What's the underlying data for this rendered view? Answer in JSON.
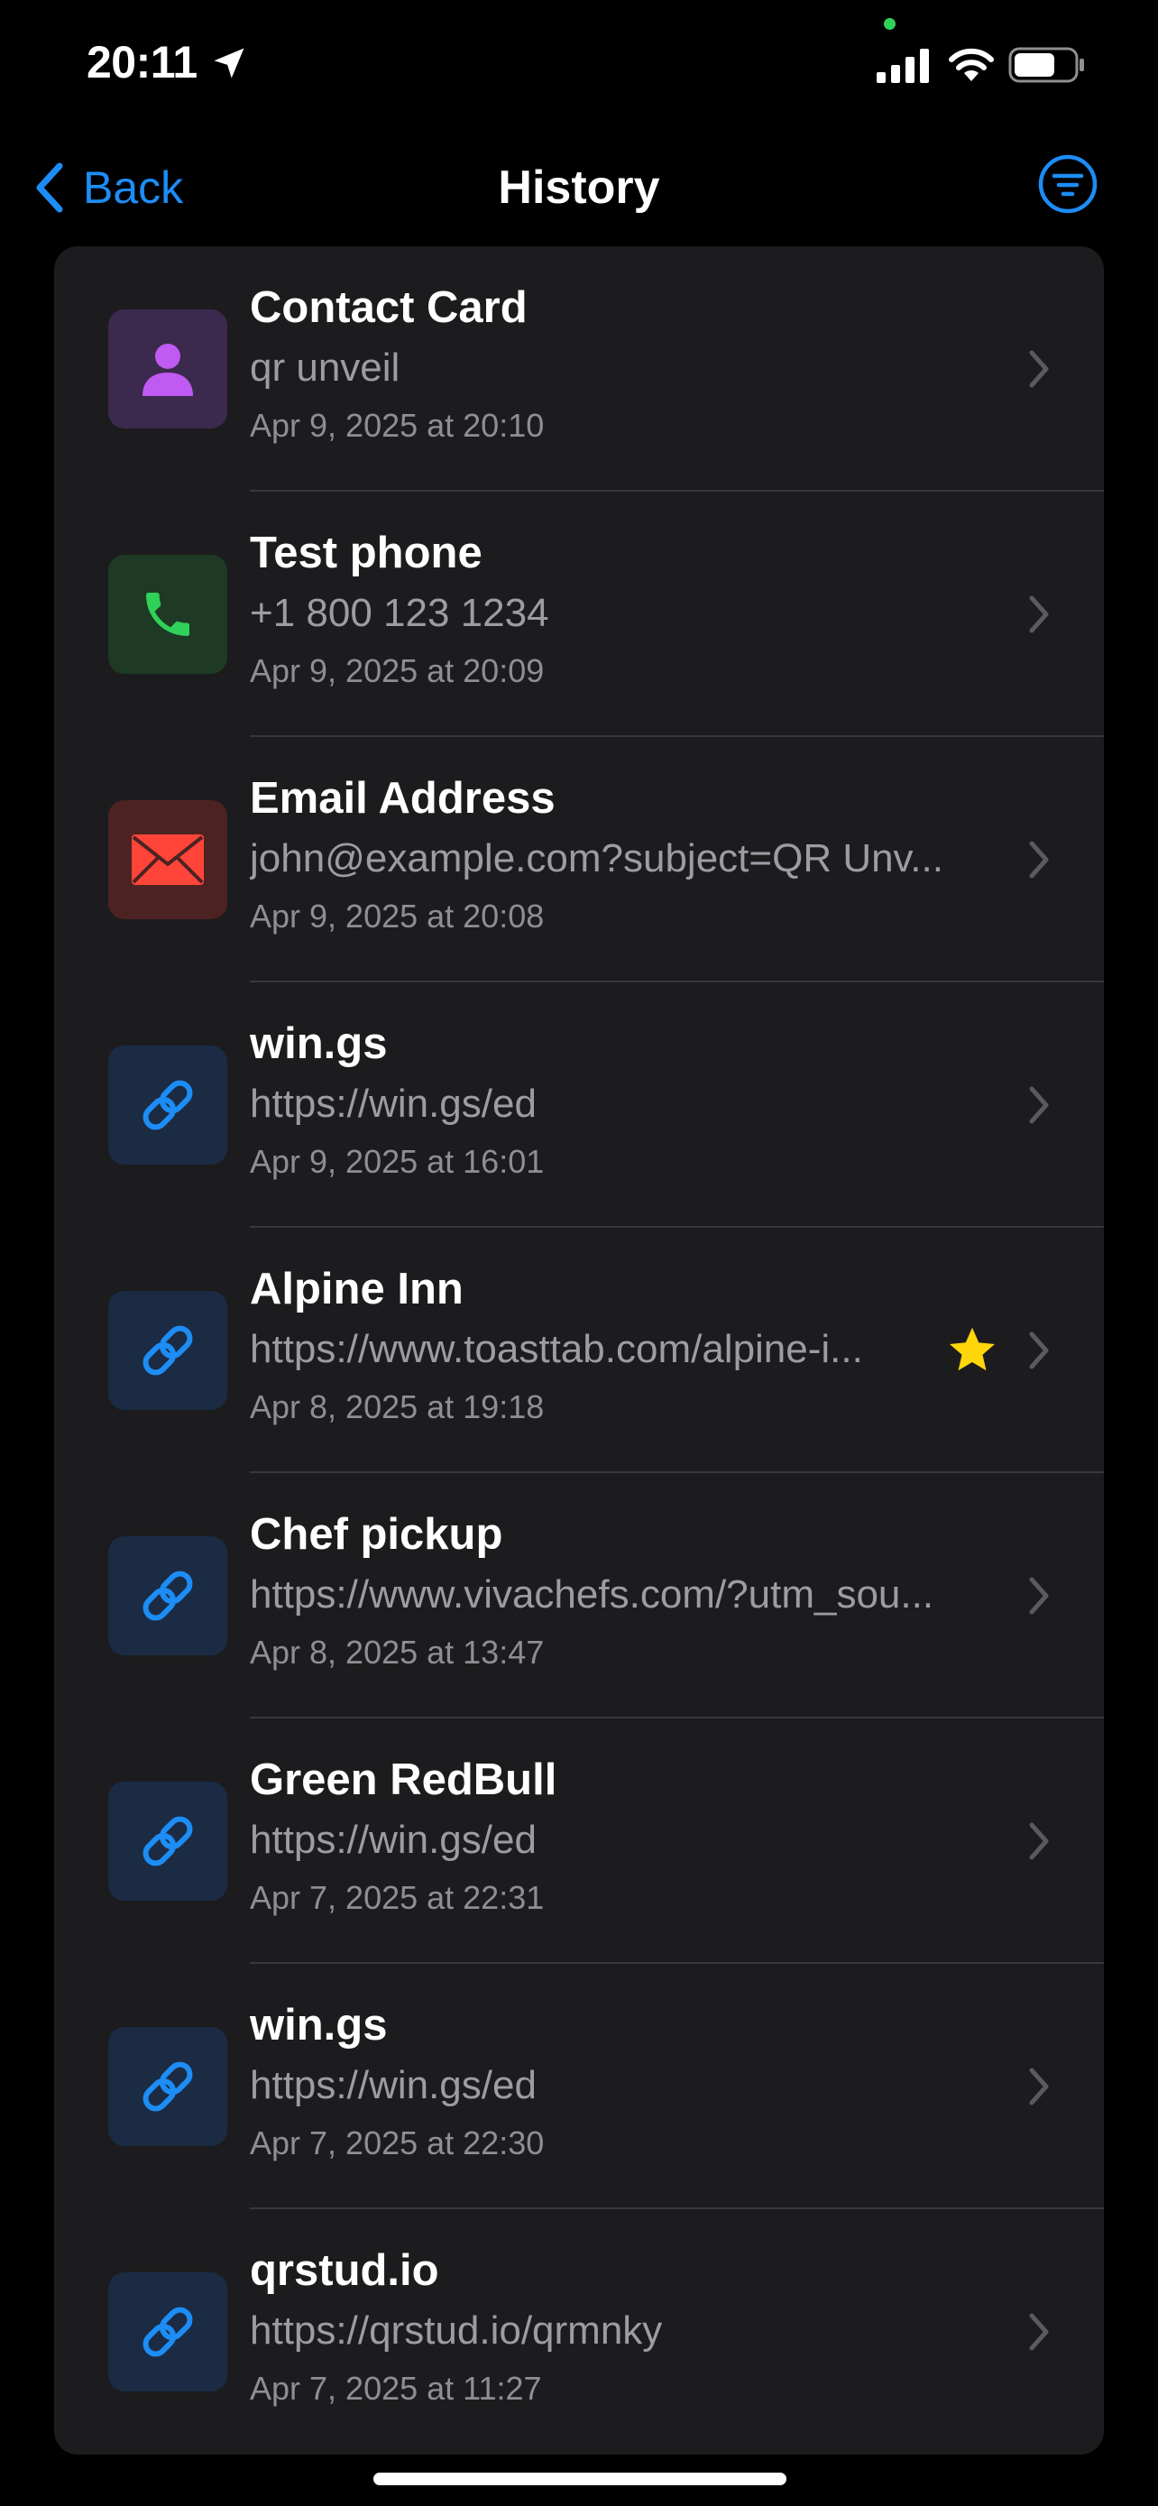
{
  "status_bar": {
    "time": "20:11"
  },
  "nav": {
    "back_label": "Back",
    "title": "History"
  },
  "items": [
    {
      "title": "Contact Card",
      "subtitle": "qr unveil",
      "date": "Apr 9, 2025 at 20:10",
      "type": "contact",
      "starred": false
    },
    {
      "title": "Test phone",
      "subtitle": "+1 800 123 1234",
      "date": "Apr 9, 2025 at 20:09",
      "type": "phone",
      "starred": false
    },
    {
      "title": "Email Address",
      "subtitle": "john@example.com?subject=QR Unv...",
      "date": "Apr 9, 2025 at 20:08",
      "type": "email",
      "starred": false
    },
    {
      "title": "win.gs",
      "subtitle": "https://win.gs/ed",
      "date": "Apr 9, 2025 at 16:01",
      "type": "link",
      "starred": false
    },
    {
      "title": "Alpine Inn",
      "subtitle": "https://www.toasttab.com/alpine-i...",
      "date": "Apr 8, 2025 at 19:18",
      "type": "link",
      "starred": true
    },
    {
      "title": "Chef pickup",
      "subtitle": "https://www.vivachefs.com/?utm_sou...",
      "date": "Apr 8, 2025 at 13:47",
      "type": "link",
      "starred": false
    },
    {
      "title": "Green RedBull",
      "subtitle": "https://win.gs/ed",
      "date": "Apr 7, 2025 at 22:31",
      "type": "link",
      "starred": false
    },
    {
      "title": "win.gs",
      "subtitle": "https://win.gs/ed",
      "date": "Apr 7, 2025 at 22:30",
      "type": "link",
      "starred": false
    },
    {
      "title": "qrstud.io",
      "subtitle": "https://qrstud.io/qrmnky",
      "date": "Apr 7, 2025 at 11:27",
      "type": "link",
      "starred": false
    }
  ],
  "colors": {
    "accent": "#1d8df5",
    "star": "#ffd60a",
    "contact": "#bf5af2",
    "phone": "#30d158",
    "email": "#ff453a"
  }
}
